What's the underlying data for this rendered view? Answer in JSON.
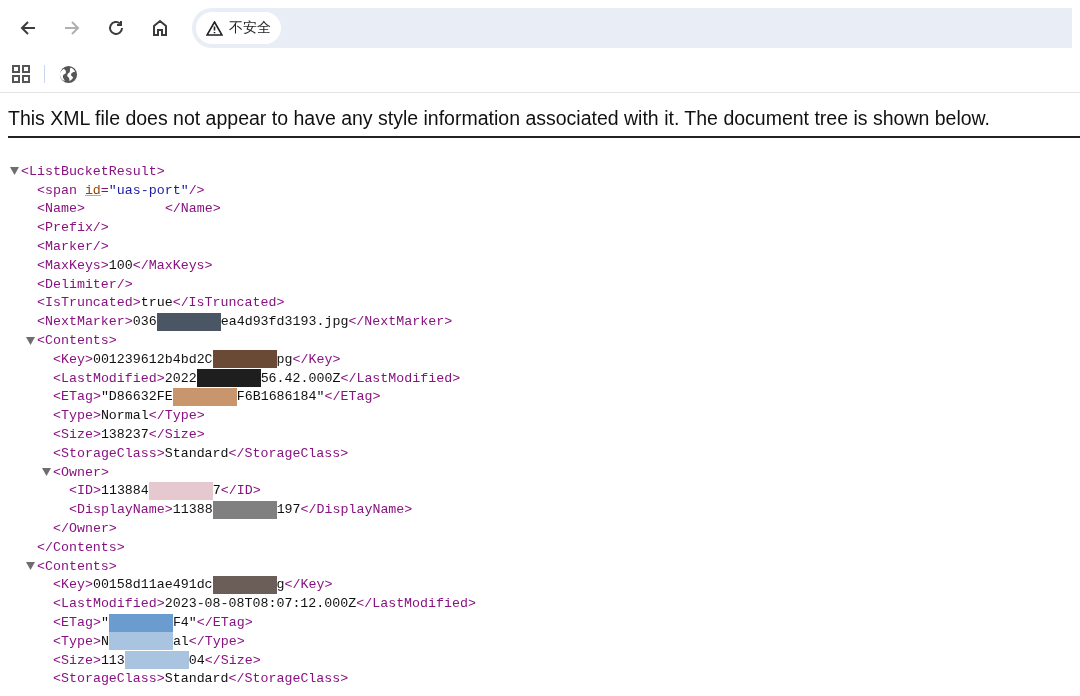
{
  "browser": {
    "back_disabled": false,
    "forward_disabled": true,
    "security_label": "不安全"
  },
  "notice": "This XML file does not appear to have any style information associated with it. The document tree is shown below.",
  "tree": [
    {
      "kind": "element",
      "open": "<ListBucketResult>",
      "expanded": true,
      "children": [
        {
          "kind": "attr",
          "tag_start": "<span",
          "attr_name": "id",
          "equals": "=",
          "attr_value": "\"uas-port\"",
          "tag_end": "/>"
        },
        {
          "kind": "leaf",
          "open": "<Name>",
          "segments": [
            {
              "kind": "blank"
            }
          ],
          "close": "</Name>"
        },
        {
          "kind": "empty",
          "open": "<Prefix/>"
        },
        {
          "kind": "empty",
          "open": "<Marker/>"
        },
        {
          "kind": "leaf",
          "open": "<MaxKeys>",
          "segments": [
            {
              "kind": "text",
              "text": "100"
            }
          ],
          "close": "</MaxKeys>"
        },
        {
          "kind": "empty",
          "open": "<Delimiter/>"
        },
        {
          "kind": "leaf",
          "open": "<IsTruncated>",
          "segments": [
            {
              "kind": "text",
              "text": "true"
            }
          ],
          "close": "</IsTruncated>"
        },
        {
          "kind": "leaf",
          "open": "<NextMarker>",
          "segments": [
            {
              "kind": "text",
              "text": "036"
            },
            {
              "kind": "redaction",
              "color": "#4a5663"
            },
            {
              "kind": "text",
              "text": "ea4d93fd3193.jpg"
            }
          ],
          "close": "</NextMarker>"
        },
        {
          "kind": "element",
          "open": "<Contents>",
          "expanded": true,
          "close": "</Contents>",
          "children": [
            {
              "kind": "leaf",
              "open": "<Key>",
              "segments": [
                {
                  "kind": "text",
                  "text": "001239612b4bd2C"
                },
                {
                  "kind": "redaction",
                  "color": "#6b4a35"
                },
                {
                  "kind": "text",
                  "text": "pg"
                }
              ],
              "close": "</Key>"
            },
            {
              "kind": "leaf",
              "open": "<LastModified>",
              "segments": [
                {
                  "kind": "text",
                  "text": "2022"
                },
                {
                  "kind": "redaction",
                  "color": "#1e1e1e"
                },
                {
                  "kind": "text",
                  "text": "56.42.000Z"
                }
              ],
              "close": "</LastModified>"
            },
            {
              "kind": "leaf",
              "open": "<ETag>",
              "segments": [
                {
                  "kind": "text",
                  "text": "\"D86632FE"
                },
                {
                  "kind": "redaction",
                  "color": "#c8956c"
                },
                {
                  "kind": "text",
                  "text": "F6B1686184\""
                }
              ],
              "close": "</ETag>"
            },
            {
              "kind": "leaf",
              "open": "<Type>",
              "segments": [
                {
                  "kind": "text",
                  "text": "Normal"
                }
              ],
              "close": "</Type>"
            },
            {
              "kind": "leaf",
              "open": "<Size>",
              "segments": [
                {
                  "kind": "text",
                  "text": "138237"
                }
              ],
              "close": "</Size>"
            },
            {
              "kind": "leaf",
              "open": "<StorageClass>",
              "segments": [
                {
                  "kind": "text",
                  "text": "Standard"
                }
              ],
              "close": "</StorageClass>"
            },
            {
              "kind": "element",
              "open": "<Owner>",
              "expanded": true,
              "close": "</Owner>",
              "children": [
                {
                  "kind": "leaf",
                  "open": "<ID>",
                  "segments": [
                    {
                      "kind": "text",
                      "text": "113884"
                    },
                    {
                      "kind": "redaction",
                      "color": "#e6c8cf"
                    },
                    {
                      "kind": "text",
                      "text": "7"
                    }
                  ],
                  "close": "</ID>"
                },
                {
                  "kind": "leaf",
                  "open": "<DisplayName>",
                  "segments": [
                    {
                      "kind": "text",
                      "text": "11388"
                    },
                    {
                      "kind": "redaction",
                      "color": "#808080"
                    },
                    {
                      "kind": "text",
                      "text": "197"
                    }
                  ],
                  "close": "</DisplayName>"
                }
              ]
            }
          ]
        },
        {
          "kind": "element",
          "open": "<Contents>",
          "expanded": true,
          "children": [
            {
              "kind": "leaf",
              "open": "<Key>",
              "segments": [
                {
                  "kind": "text",
                  "text": "00158d11ae491dc"
                },
                {
                  "kind": "redaction",
                  "color": "#6b5e58"
                },
                {
                  "kind": "text",
                  "text": "g"
                }
              ],
              "close": "</Key>"
            },
            {
              "kind": "leaf",
              "open": "<LastModified>",
              "segments": [
                {
                  "kind": "text",
                  "text": "2023-08-08T08:07:12.000Z"
                }
              ],
              "close": "</LastModified>"
            },
            {
              "kind": "leaf",
              "open": "<ETag>",
              "segments": [
                {
                  "kind": "text",
                  "text": "\""
                },
                {
                  "kind": "redaction",
                  "color": "#6a9ccf"
                },
                {
                  "kind": "text",
                  "text": "F4\""
                }
              ],
              "close": "</ETag>"
            },
            {
              "kind": "leaf",
              "open": "<Type>",
              "segments": [
                {
                  "kind": "text",
                  "text": "N"
                },
                {
                  "kind": "redaction",
                  "color": "#a8c4e0"
                },
                {
                  "kind": "text",
                  "text": "al"
                }
              ],
              "close": "</Type>"
            },
            {
              "kind": "leaf",
              "open": "<Size>",
              "segments": [
                {
                  "kind": "text",
                  "text": "113"
                },
                {
                  "kind": "redaction",
                  "color": "#a8c4e0"
                },
                {
                  "kind": "text",
                  "text": "04"
                }
              ],
              "close": "</Size>"
            },
            {
              "kind": "leaf",
              "open": "<StorageClass>",
              "segments": [
                {
                  "kind": "text",
                  "text": "Standard"
                }
              ],
              "close": "</StorageClass>"
            }
          ]
        }
      ]
    }
  ]
}
